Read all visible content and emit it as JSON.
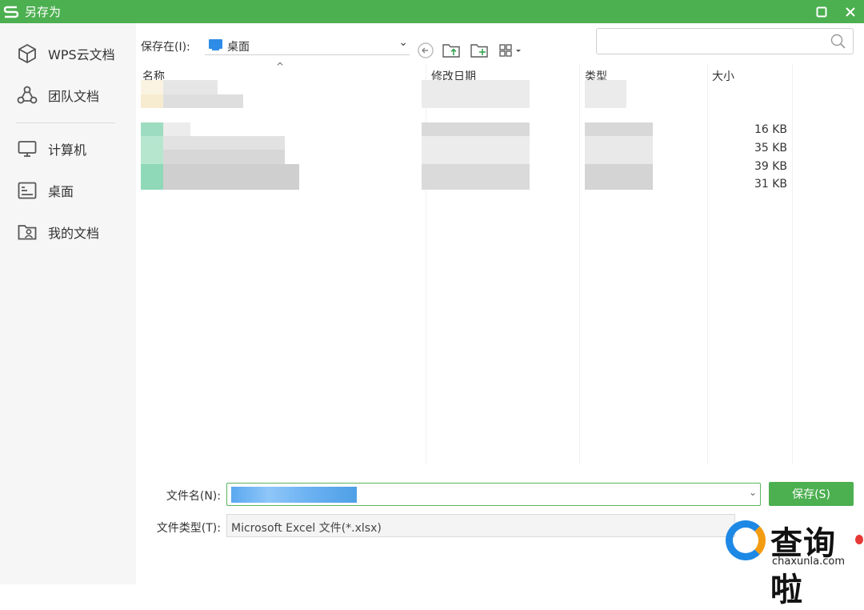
{
  "window": {
    "title": "另存为",
    "accent": "#4caf50"
  },
  "sidebar": {
    "items": [
      {
        "label": "WPS云文档",
        "icon": "cube-icon"
      },
      {
        "label": "团队文档",
        "icon": "team-icon"
      },
      {
        "label": "计算机",
        "icon": "monitor-icon"
      },
      {
        "label": "桌面",
        "icon": "desktop-icon"
      },
      {
        "label": "我的文档",
        "icon": "user-folder-icon"
      }
    ]
  },
  "toolbar": {
    "look_in_label": "保存在(I):",
    "look_in_value": "桌面",
    "search_placeholder": ""
  },
  "file_list": {
    "columns": [
      "名称",
      "修改日期",
      "类型",
      "大小"
    ],
    "sizes": [
      "16 KB",
      "35 KB",
      "39 KB",
      "31 KB"
    ]
  },
  "form": {
    "filename_label": "文件名(N):",
    "filetype_label": "文件类型(T):",
    "filetype_value": "Microsoft Excel 文件(*.xlsx)",
    "save_label": "保存(S)"
  },
  "watermark": {
    "brand": "查询啦",
    "domain": "chaxunla.com"
  }
}
